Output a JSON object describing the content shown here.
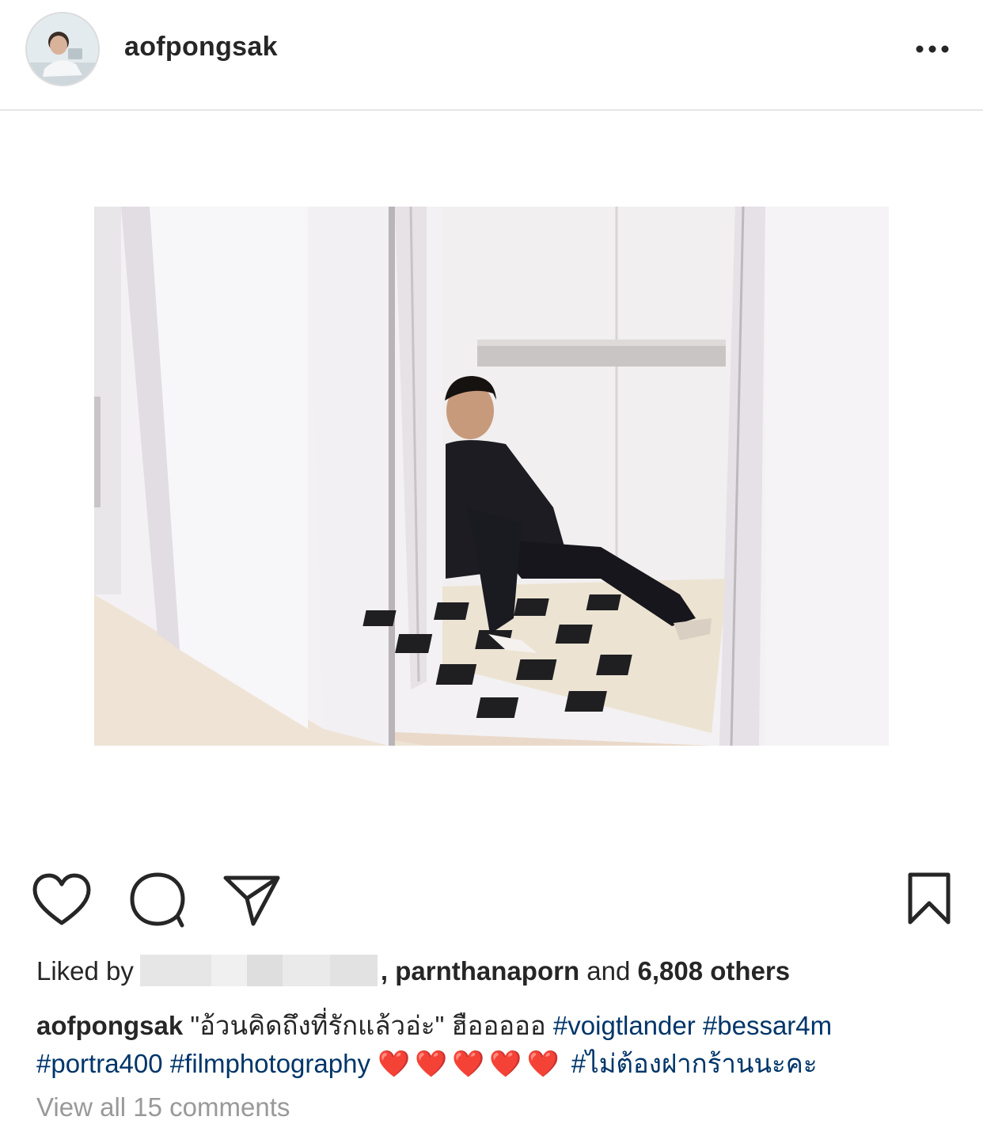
{
  "post": {
    "username": "aofpongsak",
    "liked_by_prefix": "Liked by",
    "liked_by_user": ", parnthanaporn",
    "liked_and": "and",
    "liked_others": "6,808 others",
    "caption_user": "aofpongsak",
    "caption_text": "\"อ้วนคิดถึงที่รักแล้วอ่ะ\" ฮือออออ",
    "hashtags_line1": [
      "#voigtlander",
      "#bessar4m"
    ],
    "hashtags_line2": [
      "#portra400",
      "#filmphotography"
    ],
    "hearts": "❤️❤️❤️❤️❤️",
    "hashtag_thai": "#ไม่ต้องฝากร้านนะคะ",
    "view_comments": "View all 15 comments"
  },
  "icons": {
    "avatar": "avatar",
    "more": "more-dots-icon",
    "like": "heart-icon",
    "comment": "comment-bubble-icon",
    "share": "send-arrow-icon",
    "save": "bookmark-icon"
  },
  "colors": {
    "hashtag": "#003569",
    "text": "#262626",
    "muted": "#999999",
    "heart": "#e0102a"
  }
}
